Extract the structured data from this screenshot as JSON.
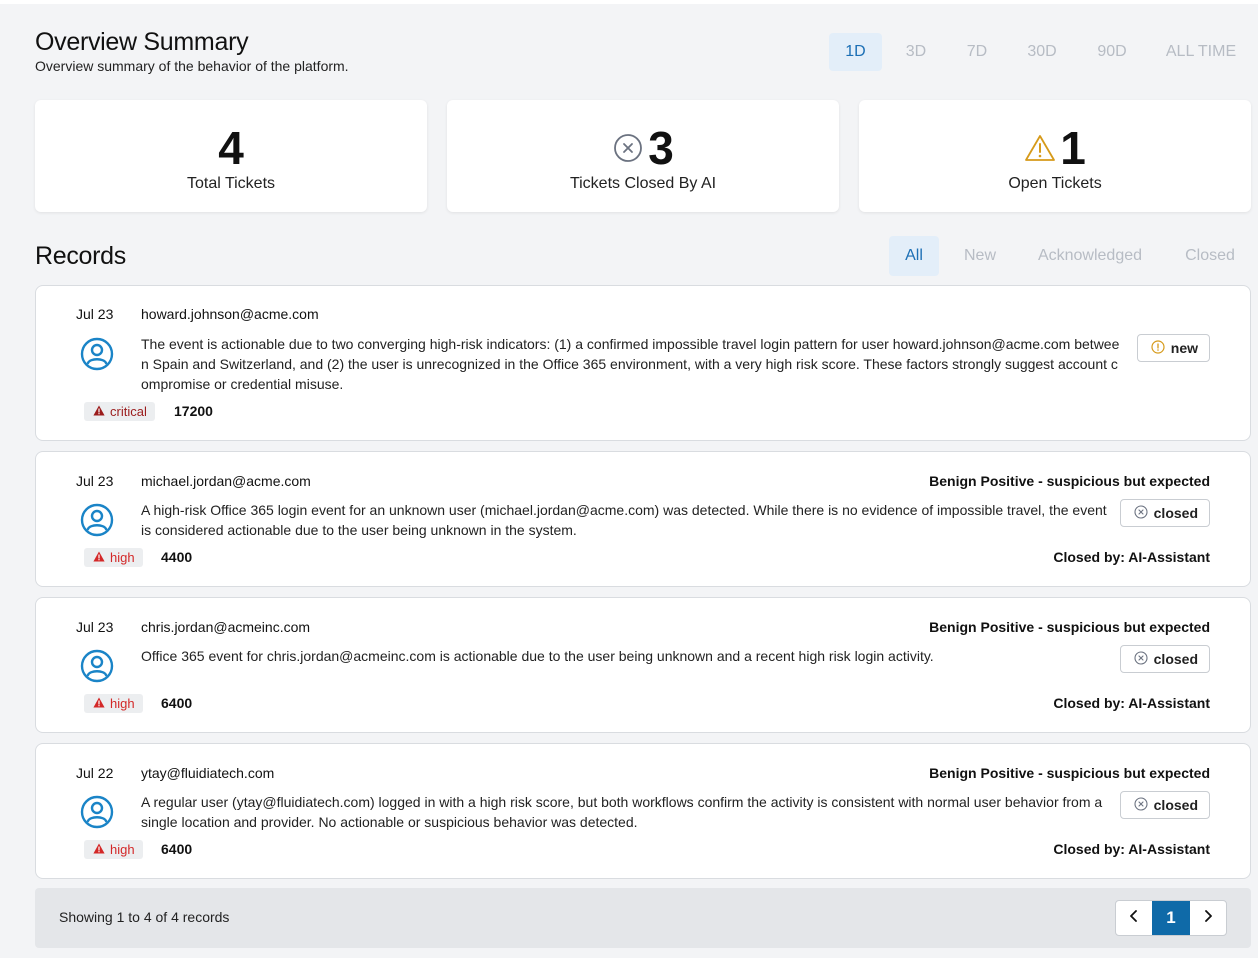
{
  "header": {
    "title": "Overview Summary",
    "subtitle": "Overview summary of the behavior of the platform."
  },
  "range_tabs": [
    {
      "label": "1D",
      "active": true
    },
    {
      "label": "3D",
      "active": false
    },
    {
      "label": "7D",
      "active": false
    },
    {
      "label": "30D",
      "active": false
    },
    {
      "label": "90D",
      "active": false
    },
    {
      "label": "ALL TIME",
      "active": false
    }
  ],
  "stats": {
    "total": {
      "value": "4",
      "label": "Total Tickets"
    },
    "closed_by_ai": {
      "value": "3",
      "label": "Tickets Closed By AI",
      "icon": "x-circle-icon"
    },
    "open": {
      "value": "1",
      "label": "Open Tickets",
      "icon": "warning-triangle-icon"
    }
  },
  "records_section": {
    "title": "Records",
    "tabs": [
      {
        "label": "All",
        "active": true
      },
      {
        "label": "New",
        "active": false
      },
      {
        "label": "Acknowledged",
        "active": false
      },
      {
        "label": "Closed",
        "active": false
      }
    ]
  },
  "records": [
    {
      "date": "Jul 23",
      "user": "howard.johnson@acme.com",
      "description": "The event is actionable due to two converging high-risk indicators: (1) a confirmed impossible travel login pattern for user howard.johnson@acme.com between Spain and Switzerland, and (2) the user is unrecognized in the Office 365 environment, with a very high risk score. These factors strongly suggest account compromise or credential misuse.",
      "verdict": "",
      "status": "new",
      "closed_by": "",
      "severity": "critical",
      "score": "17200"
    },
    {
      "date": "Jul 23",
      "user": "michael.jordan@acme.com",
      "description": "A high-risk Office 365 login event for an unknown user (michael.jordan@acme.com) was detected. While there is no evidence of impossible travel, the event is considered actionable due to the user being unknown in the system.",
      "verdict": "Benign Positive - suspicious but expected",
      "status": "closed",
      "closed_by": "Closed by: AI-Assistant",
      "severity": "high",
      "score": "4400"
    },
    {
      "date": "Jul 23",
      "user": "chris.jordan@acmeinc.com",
      "description": "Office 365 event for chris.jordan@acmeinc.com is actionable due to the user being unknown and a recent high risk login activity.",
      "verdict": "Benign Positive - suspicious but expected",
      "status": "closed",
      "closed_by": "Closed by: AI-Assistant",
      "severity": "high",
      "score": "6400"
    },
    {
      "date": "Jul 22",
      "user": "ytay@fluidiatech.com",
      "description": "A regular user (ytay@fluidiatech.com) logged in with a high risk score, but both workflows confirm the activity is consistent with normal user behavior from a single location and provider. No actionable or suspicious behavior was detected.",
      "verdict": "Benign Positive - suspicious but expected",
      "status": "closed",
      "closed_by": "Closed by: AI-Assistant",
      "severity": "high",
      "score": "6400"
    }
  ],
  "footer": {
    "showing": "Showing 1 to 4 of 4 records",
    "current_page": "1",
    "prev_icon": "chevron-left-icon",
    "next_icon": "chevron-right-icon"
  },
  "colors": {
    "accent": "#1c6fb5",
    "avatar": "#1a84c7",
    "critical": "#9b1c1c",
    "high": "#d32828",
    "warning": "#d69a1a",
    "page_active": "#0f6aa8"
  }
}
